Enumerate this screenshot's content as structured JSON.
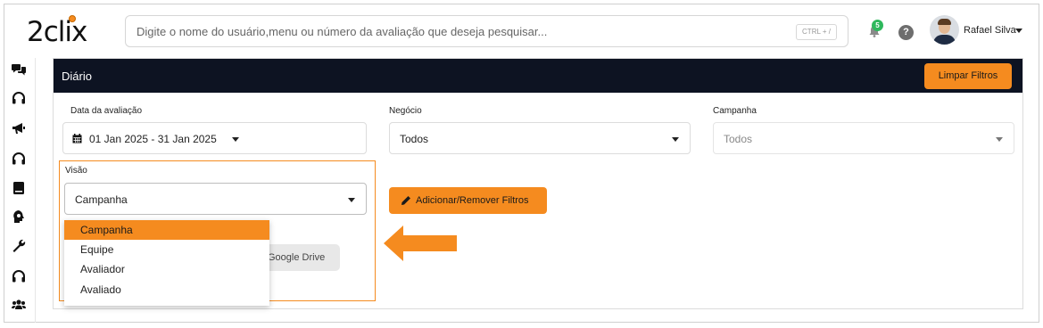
{
  "header": {
    "logo_text": "2clix",
    "search_placeholder": "Digite o nome do usuário,menu ou número da avaliação que deseja pesquisar...",
    "search_shortcut": "CTRL + /",
    "notification_count": "5",
    "help_label": "?",
    "user_name": "Rafael Silva"
  },
  "sidebar": {
    "icons": [
      "comments-icon",
      "headset-icon",
      "megaphone-icon",
      "headset-icon",
      "book-icon",
      "brain-icon",
      "wrench-icon",
      "headset-icon",
      "users-icon"
    ]
  },
  "card": {
    "title": "Diário",
    "clear_filters_label": "Limpar Filtros"
  },
  "filters": {
    "date_label": "Data da avaliação",
    "date_value": "01 Jan 2025 - 31 Jan 2025",
    "business_label": "Negócio",
    "business_value": "Todos",
    "campaign_label": "Campanha",
    "campaign_value": "Todos",
    "view_label": "Visão",
    "view_value": "Campanha",
    "add_remove_label": "Adicionar/Remover Filtros",
    "gdrive_label": "Google Drive"
  },
  "view_dropdown": {
    "options": [
      "Campanha",
      "Equipe",
      "Avaliador",
      "Avaliado"
    ],
    "selected_index": 0
  },
  "colors": {
    "accent": "#f58b1f",
    "header_dark": "#0d1322",
    "badge_green": "#2eb85c"
  }
}
